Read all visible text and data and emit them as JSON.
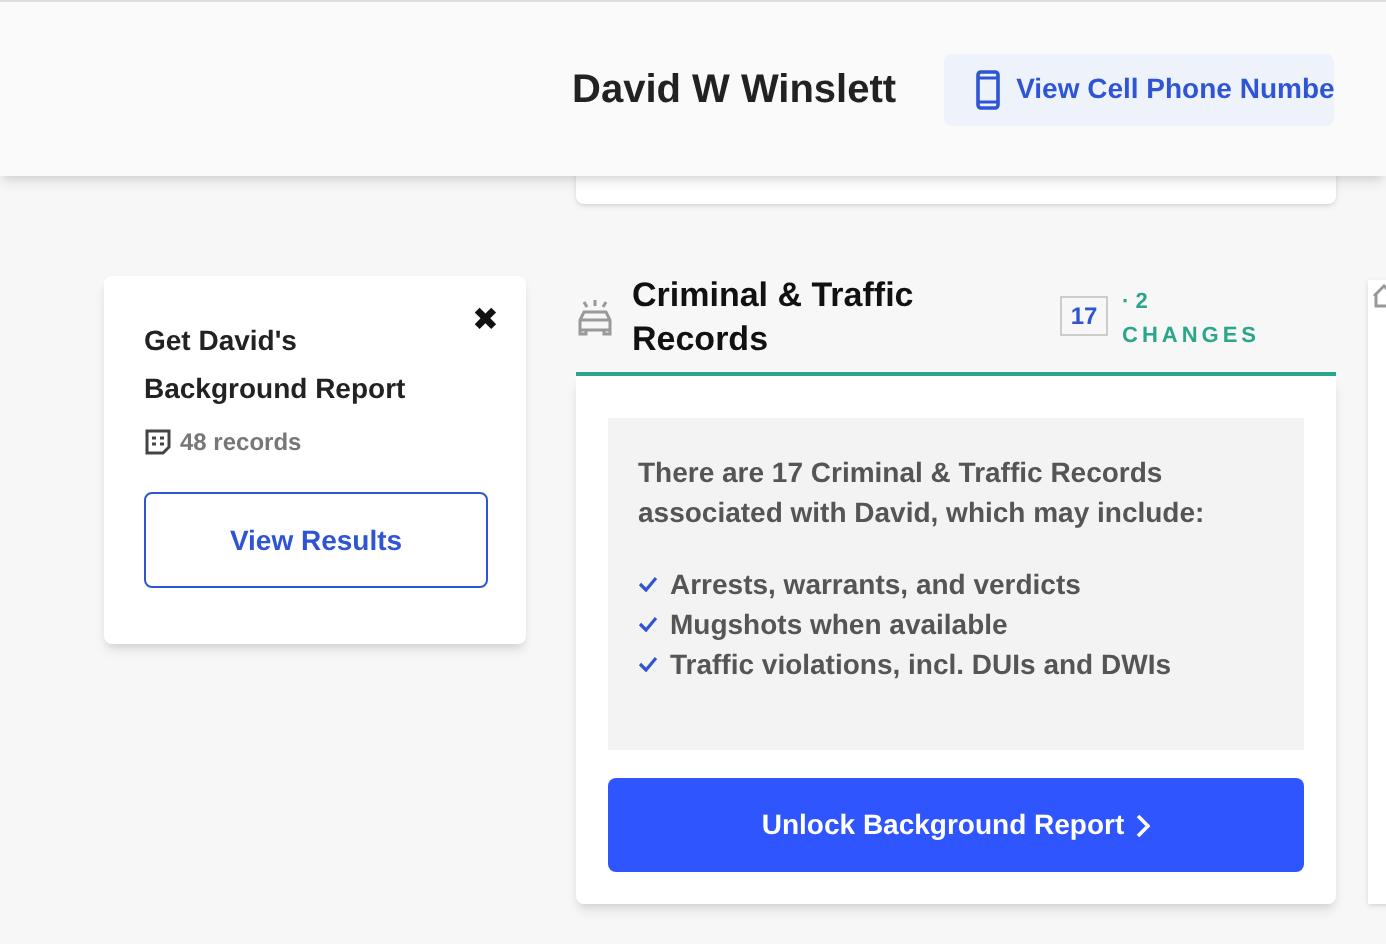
{
  "header": {
    "person_name": "David W Winslett",
    "phone_button": "View Cell Phone Numbe"
  },
  "promo_card": {
    "title": "Get David's Background Report",
    "records": "48 records",
    "button": "View Results",
    "close": "✖"
  },
  "section": {
    "title": "Criminal & Traffic Records",
    "count": "17",
    "changes": "· 2",
    "changes_label": "CHANGES",
    "intro": "There are 17 Criminal & Traffic Records associated with David, which may include:",
    "items": [
      "Arrests, warrants, and verdicts",
      "Mugshots when available",
      "Traffic violations, incl. DUIs and DWIs"
    ],
    "button": "Unlock Background Report"
  }
}
